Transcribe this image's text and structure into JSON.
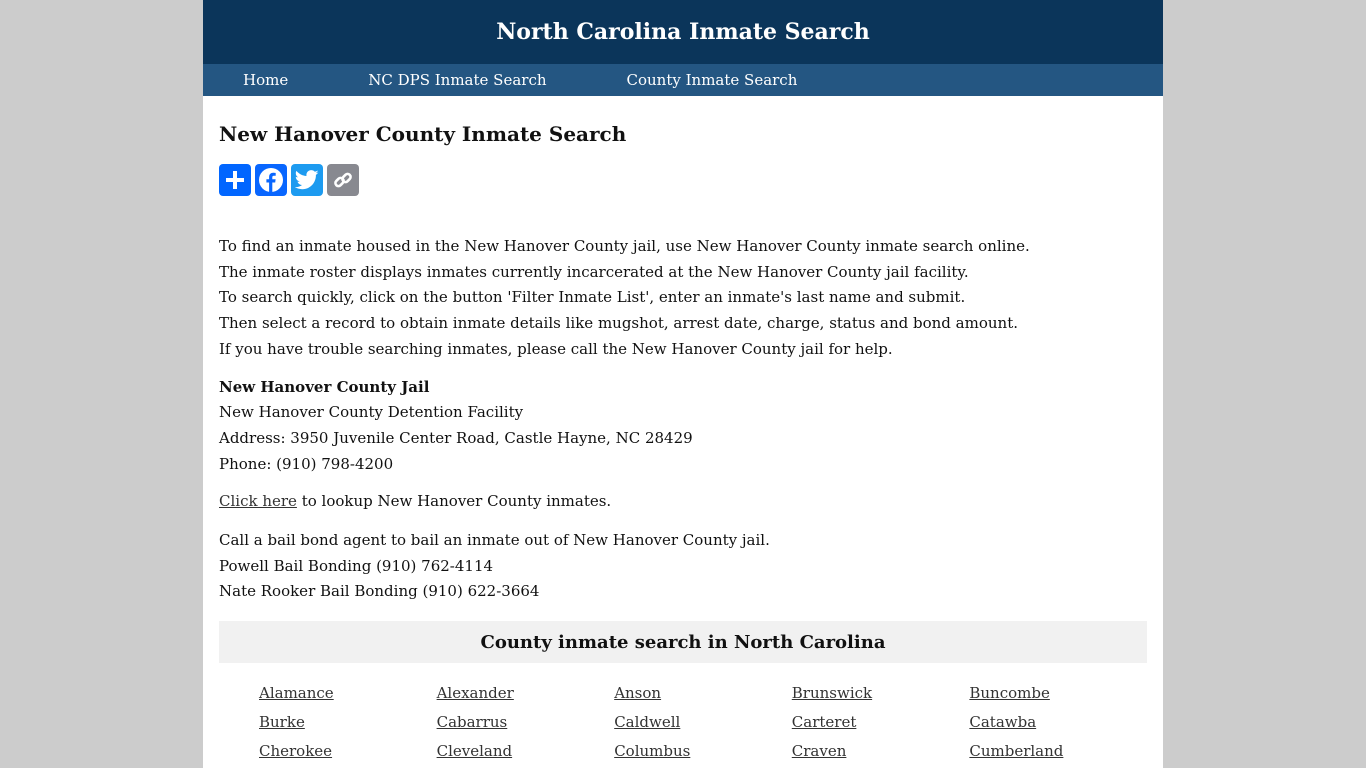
{
  "header": {
    "title": "North Carolina Inmate Search"
  },
  "nav": {
    "items": [
      {
        "label": "Home"
      },
      {
        "label": "NC DPS Inmate Search"
      },
      {
        "label": "County Inmate Search"
      }
    ]
  },
  "main": {
    "title": "New Hanover County Inmate Search",
    "share": {
      "buttons": [
        {
          "icon": "plus-icon",
          "label": "Share",
          "color": "#0166ff"
        },
        {
          "icon": "facebook-icon",
          "label": "Facebook",
          "color": "#0866ff"
        },
        {
          "icon": "twitter-icon",
          "label": "Twitter",
          "color": "#1d9bf0"
        },
        {
          "icon": "link-icon",
          "label": "Copy Link",
          "color": "#888990"
        }
      ]
    },
    "intro": [
      "To find an inmate housed in the New Hanover County jail, use New Hanover County inmate search online.",
      "The inmate roster displays inmates currently incarcerated at the New Hanover County jail facility.",
      "To search quickly, click on the button 'Filter Inmate List', enter an inmate's last name and submit.",
      "Then select a record to obtain inmate details like mugshot, arrest date, charge, status and bond amount.",
      "If you have trouble searching inmates, please call the New Hanover County jail for help."
    ],
    "jail": {
      "title": "New Hanover County Jail",
      "facility": "New Hanover County Detention Facility",
      "address": "Address: 3950 Juvenile Center Road, Castle Hayne, NC 28429",
      "phone": "Phone: (910) 798-4200"
    },
    "lookup": {
      "link_label": "Click here",
      "text": " to lookup New Hanover County inmates."
    },
    "bail": [
      "Call a bail bond agent to bail an inmate out of New Hanover County jail.",
      "Powell Bail Bonding (910) 762-4114",
      "Nate Rooker Bail Bonding (910) 622-3664"
    ]
  },
  "counties": {
    "heading": "County inmate search in North Carolina",
    "items": [
      "Alamance",
      "Alexander",
      "Anson",
      "Brunswick",
      "Buncombe",
      "Burke",
      "Cabarrus",
      "Caldwell",
      "Carteret",
      "Catawba",
      "Cherokee",
      "Cleveland",
      "Columbus",
      "Craven",
      "Cumberland"
    ]
  },
  "colors": {
    "header_bg": "#0b355a",
    "nav_bg": "#245682",
    "page_bg": "#cccccc",
    "county_box_bg": "#f1f1f1"
  }
}
